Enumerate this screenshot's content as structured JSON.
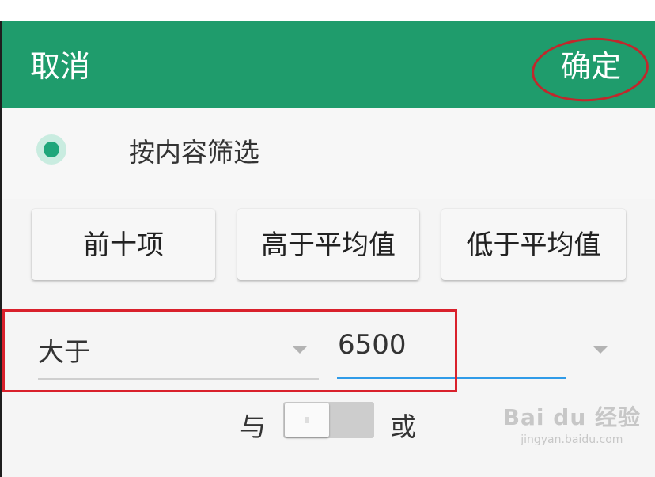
{
  "header": {
    "cancel_label": "取消",
    "confirm_label": "确定",
    "background": "#1f9c6c"
  },
  "filter_mode": {
    "label": "按内容筛选",
    "selected": true
  },
  "quick_buttons": [
    {
      "label": "前十项"
    },
    {
      "label": "高于平均值"
    },
    {
      "label": "低于平均值"
    }
  ],
  "condition": {
    "operator": "大于",
    "value": "6500"
  },
  "logic": {
    "and_label": "与",
    "or_label": "或"
  },
  "watermark": {
    "main": "Bai du 经验",
    "sub": "jingyan.baidu.com"
  },
  "annotation_colors": {
    "ring": "#c0282c",
    "box": "#d9212c"
  },
  "icons": [
    "radio-selected-icon",
    "dropdown-caret-icon"
  ]
}
